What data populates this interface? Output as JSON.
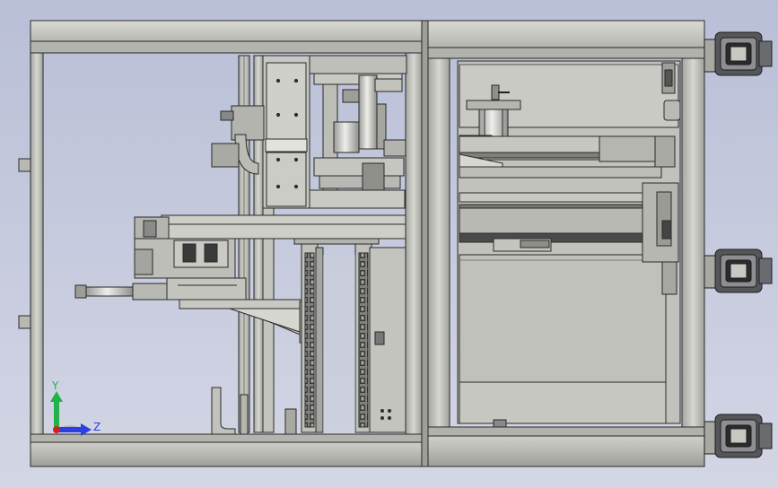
{
  "view": {
    "background_top": "#b9bfd7",
    "background_bottom": "#d3d6e4",
    "frame_color": "#c3c4bd",
    "frame_shadow": "#8d8f88",
    "edge_color": "#2a2a2a"
  },
  "triad": {
    "y_label": "Y",
    "z_label": "Z",
    "y_color": "#23b24a",
    "z_color": "#2c3fe0",
    "x_color": "#d62020"
  }
}
